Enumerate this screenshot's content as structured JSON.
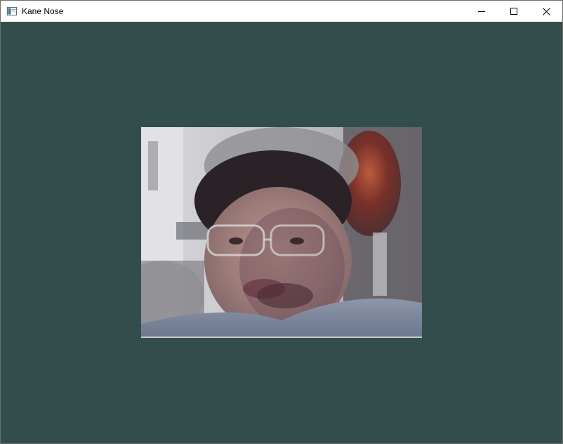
{
  "window": {
    "title": "Kane Nose",
    "icon": "app-window-icon",
    "controls": {
      "minimize": "minimize-icon",
      "maximize": "maximize-icon",
      "close": "close-icon"
    }
  },
  "client": {
    "background_color": "#334d4d",
    "image": {
      "description_icon": "face-photo"
    }
  }
}
